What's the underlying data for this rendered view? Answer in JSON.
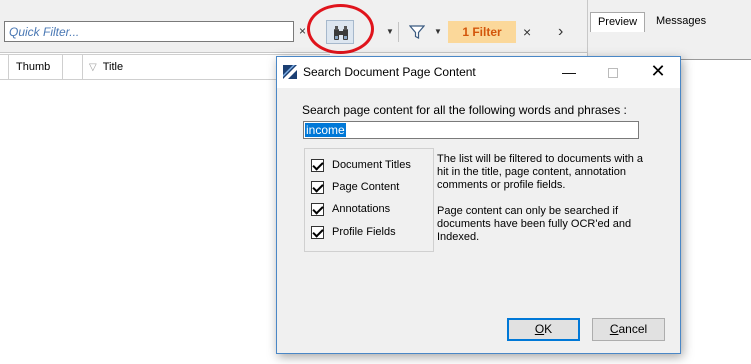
{
  "toolbar": {
    "quick_filter_placeholder": "Quick Filter...",
    "clear_glyph": "×",
    "dropdown_glyph": "▼",
    "filter_badge": "1 Filter",
    "remove_filter_glyph": "×",
    "nav_glyph": "›",
    "highlight_color": "#e0141c"
  },
  "right_pane": {
    "tabs": [
      {
        "label": "Preview",
        "active": true
      },
      {
        "label": "Messages",
        "active": false
      }
    ]
  },
  "grid": {
    "columns": [
      "Thumb",
      "Title"
    ],
    "title_filter_glyph": "▽"
  },
  "dialog": {
    "title": "Search Document Page Content",
    "prompt": "Search page content for all the following words and phrases :",
    "search_value": "income",
    "options": [
      {
        "label": "Document Titles",
        "checked": true
      },
      {
        "label": "Page Content",
        "checked": true
      },
      {
        "label": "Annotations",
        "checked": true
      },
      {
        "label": "Profile Fields",
        "checked": true
      }
    ],
    "help_text_1": "The list will be filtered to documents with a hit in the title, page content, annotation comments or profile fields.",
    "help_text_2": "Page content can only be searched if documents have been fully OCR'ed and Indexed.",
    "ok_label_mnemonic": "O",
    "ok_label_rest": "K",
    "cancel_label_mnemonic": "C",
    "cancel_label_rest": "ancel",
    "window_glyphs": {
      "minimize": "—",
      "close": "✕"
    }
  }
}
